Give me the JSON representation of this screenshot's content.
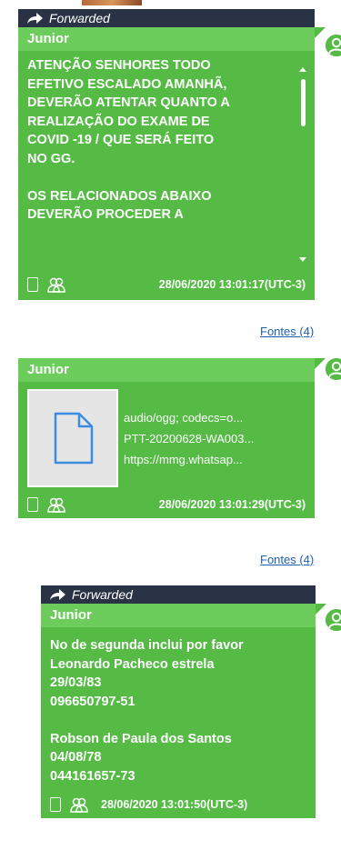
{
  "colors": {
    "bubble": "#55bb45",
    "sender_bar": "#6ccd5c",
    "forward_bar": "#2a3346",
    "link": "#1f5fb0"
  },
  "messages": [
    {
      "forwarded_label": "Forwarded",
      "sender": "Junior",
      "text": "ATENÇÃO SENHORES TODO\nEFETIVO ESCALADO AMANHÃ,\nDEVERÃO ATENTAR QUANTO A\nREALIZAÇÃO DO EXAME DE\nCOVID -19 / QUE SERÁ FEITO\nNO GG.\n\nOS RELACIONADOS ABAIXO\nDEVERÃO PROCEDER A",
      "timestamp": "28/06/2020 13:01:17(UTC-3)",
      "sources_link": "Fontes (4)"
    },
    {
      "sender": "Junior",
      "attachment": {
        "mime": "audio/ogg; codecs=o...",
        "filename": "PTT-20200628-WA003...",
        "url": "https://mmg.whatsap..."
      },
      "timestamp": "28/06/2020 13:01:29(UTC-3)",
      "sources_link": "Fontes (4)"
    },
    {
      "forwarded_label": "Forwarded",
      "sender": "Junior",
      "text": "No de segunda inclui por favor\nLeonardo Pacheco estrela\n29/03/83\n096650797-51\n\nRobson de Paula dos Santos\n04/08/78\n044161657-73",
      "timestamp": "28/06/2020 13:01:50(UTC-3)"
    }
  ]
}
